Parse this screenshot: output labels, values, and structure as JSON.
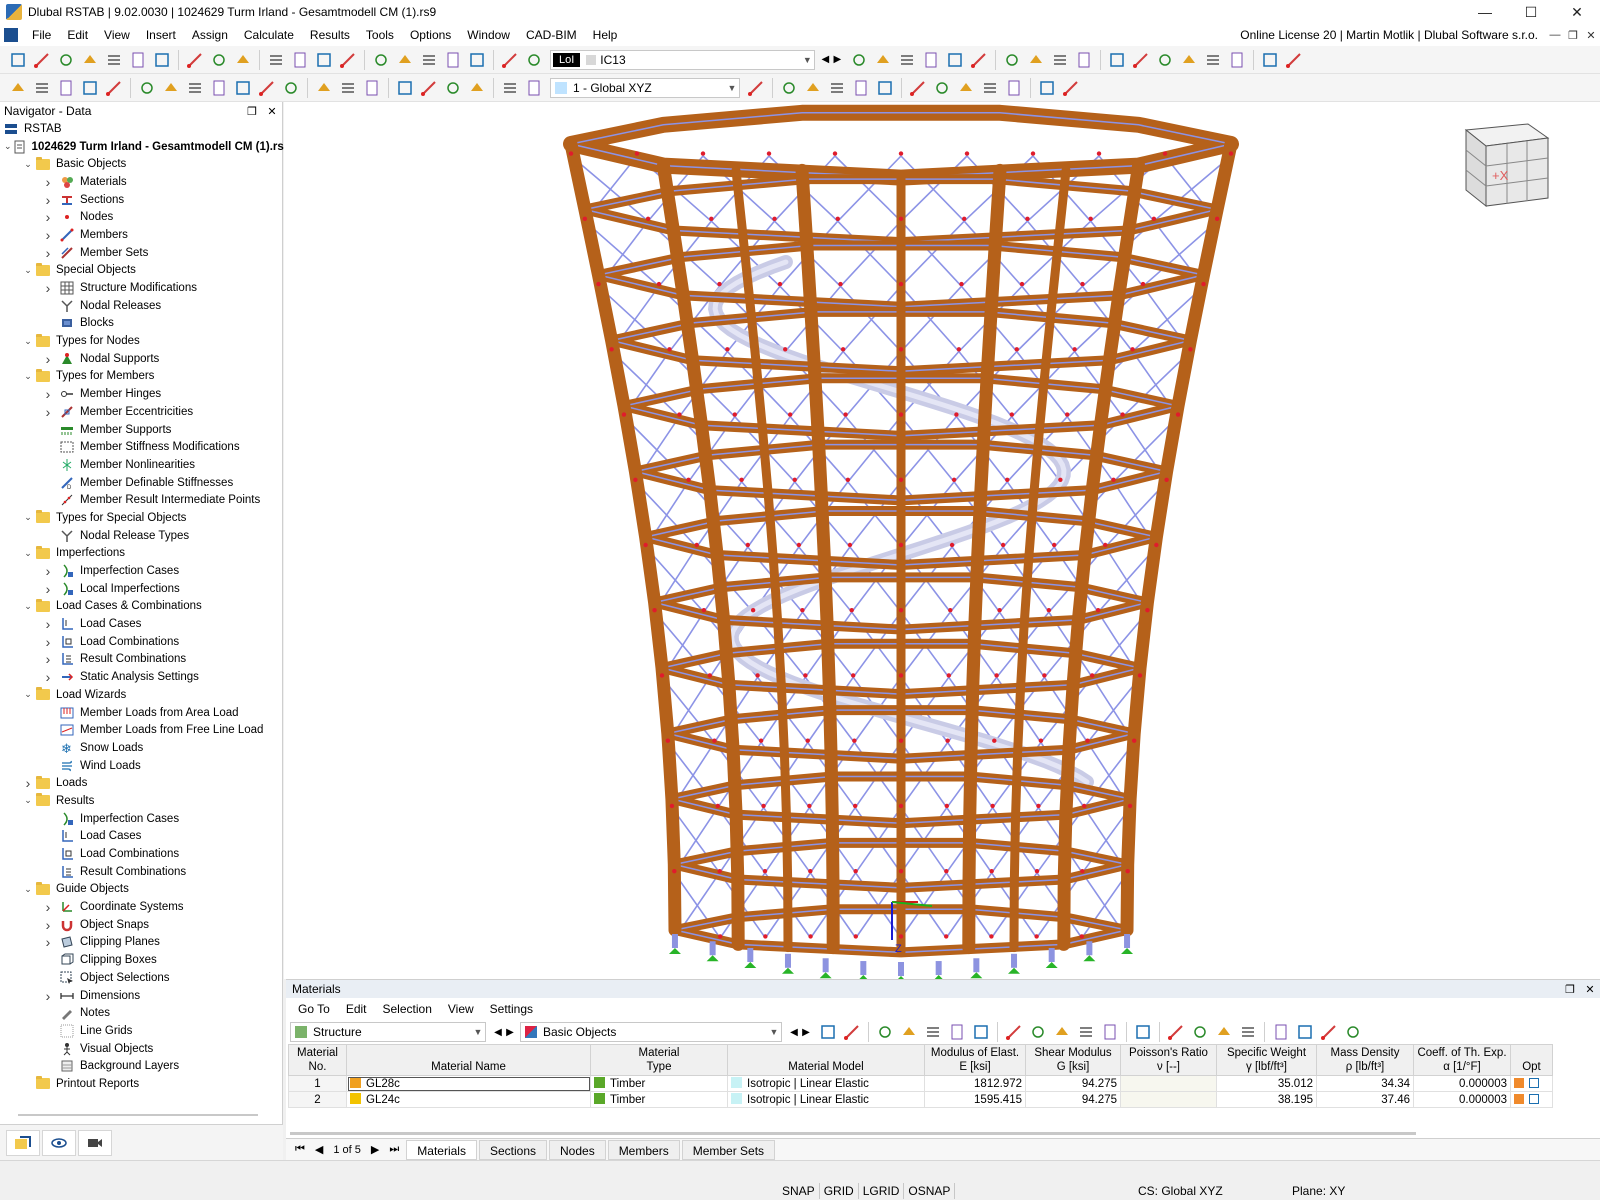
{
  "window": {
    "title": "Dlubal RSTAB | 9.02.0030 | 1024629 Turm Irland - Gesamtmodell CM (1).rs9",
    "minimize": "—",
    "maximize": "☐",
    "close": "✕"
  },
  "menu": {
    "items": [
      "File",
      "Edit",
      "View",
      "Insert",
      "Assign",
      "Calculate",
      "Results",
      "Tools",
      "Options",
      "Window",
      "CAD-BIM",
      "Help"
    ],
    "license": "Online License 20 | Martin Motlik | Dlubal Software s.r.o."
  },
  "toolbar": {
    "load_case_tag": "LoI",
    "load_case": "IC13",
    "coordinate_system": "1 - Global XYZ"
  },
  "navigator": {
    "title": "Navigator - Data",
    "root": "RSTAB",
    "model": "1024629 Turm Irland - Gesamtmodell CM (1).rs9",
    "items": [
      {
        "label": "Basic Objects",
        "level": 1,
        "kind": "folder",
        "state": "open"
      },
      {
        "label": "Materials",
        "level": 2,
        "kind": "materials-icon",
        "state": "closed"
      },
      {
        "label": "Sections",
        "level": 2,
        "kind": "sections-icon",
        "state": "closed"
      },
      {
        "label": "Nodes",
        "level": 2,
        "kind": "nodes-icon",
        "state": "closed"
      },
      {
        "label": "Members",
        "level": 2,
        "kind": "members-icon",
        "state": "closed"
      },
      {
        "label": "Member Sets",
        "level": 2,
        "kind": "member-sets-icon",
        "state": "closed"
      },
      {
        "label": "Special Objects",
        "level": 1,
        "kind": "folder",
        "state": "open"
      },
      {
        "label": "Structure Modifications",
        "level": 2,
        "kind": "grid-icon",
        "state": "closed"
      },
      {
        "label": "Nodal Releases",
        "level": 2,
        "kind": "release-icon",
        "state": "none"
      },
      {
        "label": "Blocks",
        "level": 2,
        "kind": "block-icon",
        "state": "none"
      },
      {
        "label": "Types for Nodes",
        "level": 1,
        "kind": "folder",
        "state": "open"
      },
      {
        "label": "Nodal Supports",
        "level": 2,
        "kind": "support-icon",
        "state": "closed"
      },
      {
        "label": "Types for Members",
        "level": 1,
        "kind": "folder",
        "state": "open"
      },
      {
        "label": "Member Hinges",
        "level": 2,
        "kind": "hinge-icon",
        "state": "closed"
      },
      {
        "label": "Member Eccentricities",
        "level": 2,
        "kind": "eccentricity-icon",
        "state": "closed"
      },
      {
        "label": "Member Supports",
        "level": 2,
        "kind": "member-support-icon",
        "state": "none"
      },
      {
        "label": "Member Stiffness Modifications",
        "level": 2,
        "kind": "stiffness-icon",
        "state": "none"
      },
      {
        "label": "Member Nonlinearities",
        "level": 2,
        "kind": "nonlinear-icon",
        "state": "none"
      },
      {
        "label": "Member Definable Stiffnesses",
        "level": 2,
        "kind": "definable-icon",
        "state": "none"
      },
      {
        "label": "Member Result Intermediate Points",
        "level": 2,
        "kind": "points-icon",
        "state": "none"
      },
      {
        "label": "Types for Special Objects",
        "level": 1,
        "kind": "folder",
        "state": "open"
      },
      {
        "label": "Nodal Release Types",
        "level": 2,
        "kind": "release-icon",
        "state": "none"
      },
      {
        "label": "Imperfections",
        "level": 1,
        "kind": "folder",
        "state": "open"
      },
      {
        "label": "Imperfection Cases",
        "level": 2,
        "kind": "imperfection-icon",
        "state": "closed"
      },
      {
        "label": "Local Imperfections",
        "level": 2,
        "kind": "imperfection-icon",
        "state": "closed"
      },
      {
        "label": "Load Cases & Combinations",
        "level": 1,
        "kind": "folder",
        "state": "open"
      },
      {
        "label": "Load Cases",
        "level": 2,
        "kind": "load-case-icon",
        "state": "closed"
      },
      {
        "label": "Load Combinations",
        "level": 2,
        "kind": "load-combination-icon",
        "state": "closed"
      },
      {
        "label": "Result Combinations",
        "level": 2,
        "kind": "result-combination-icon",
        "state": "closed"
      },
      {
        "label": "Static Analysis Settings",
        "level": 2,
        "kind": "analysis-icon",
        "state": "closed"
      },
      {
        "label": "Load Wizards",
        "level": 1,
        "kind": "folder",
        "state": "open"
      },
      {
        "label": "Member Loads from Area Load",
        "level": 2,
        "kind": "area-load-icon",
        "state": "none"
      },
      {
        "label": "Member Loads from Free Line Load",
        "level": 2,
        "kind": "line-load-icon",
        "state": "none"
      },
      {
        "label": "Snow Loads",
        "level": 2,
        "kind": "snow-icon",
        "state": "none"
      },
      {
        "label": "Wind Loads",
        "level": 2,
        "kind": "wind-icon",
        "state": "none"
      },
      {
        "label": "Loads",
        "level": 1,
        "kind": "folder",
        "state": "closed"
      },
      {
        "label": "Results",
        "level": 1,
        "kind": "folder",
        "state": "open"
      },
      {
        "label": "Imperfection Cases",
        "level": 2,
        "kind": "imperfection-icon",
        "state": "none"
      },
      {
        "label": "Load Cases",
        "level": 2,
        "kind": "load-case-icon",
        "state": "none"
      },
      {
        "label": "Load Combinations",
        "level": 2,
        "kind": "load-combination-icon",
        "state": "none"
      },
      {
        "label": "Result Combinations",
        "level": 2,
        "kind": "result-combination-icon",
        "state": "none"
      },
      {
        "label": "Guide Objects",
        "level": 1,
        "kind": "folder",
        "state": "open"
      },
      {
        "label": "Coordinate Systems",
        "level": 2,
        "kind": "coordinate-icon",
        "state": "closed"
      },
      {
        "label": "Object Snaps",
        "level": 2,
        "kind": "snap-icon",
        "state": "closed"
      },
      {
        "label": "Clipping Planes",
        "level": 2,
        "kind": "clipping-plane-icon",
        "state": "closed"
      },
      {
        "label": "Clipping Boxes",
        "level": 2,
        "kind": "clipping-box-icon",
        "state": "none"
      },
      {
        "label": "Object Selections",
        "level": 2,
        "kind": "selection-icon",
        "state": "none"
      },
      {
        "label": "Dimensions",
        "level": 2,
        "kind": "dimension-icon",
        "state": "closed"
      },
      {
        "label": "Notes",
        "level": 2,
        "kind": "notes-icon",
        "state": "none"
      },
      {
        "label": "Line Grids",
        "level": 2,
        "kind": "line-grid-icon",
        "state": "none"
      },
      {
        "label": "Visual Objects",
        "level": 2,
        "kind": "visual-icon",
        "state": "none"
      },
      {
        "label": "Background Layers",
        "level": 2,
        "kind": "layers-icon",
        "state": "none"
      },
      {
        "label": "Printout Reports",
        "level": 1,
        "kind": "folder",
        "state": "none"
      }
    ]
  },
  "viewport": {
    "view_cube_label": "+X",
    "axis_label": "Z"
  },
  "materials_panel": {
    "title": "Materials",
    "menu": [
      "Go To",
      "Edit",
      "Selection",
      "View",
      "Settings"
    ],
    "filter1": "Structure",
    "filter2": "Basic Objects",
    "columns": [
      {
        "line1": "Material",
        "line2": "No."
      },
      {
        "line1": "",
        "line2": "Material Name"
      },
      {
        "line1": "Material",
        "line2": "Type"
      },
      {
        "line1": "",
        "line2": "Material Model"
      },
      {
        "line1": "Modulus of Elast.",
        "line2": "E [ksi]"
      },
      {
        "line1": "Shear Modulus",
        "line2": "G [ksi]"
      },
      {
        "line1": "Poisson's Ratio",
        "line2": "ν [--]"
      },
      {
        "line1": "Specific Weight",
        "line2": "γ [lbf/ft³]"
      },
      {
        "line1": "Mass Density",
        "line2": "ρ [lb/ft³]"
      },
      {
        "line1": "Coeff. of Th. Exp.",
        "line2": "α [1/°F]"
      },
      {
        "line1": "",
        "line2": "Opt"
      }
    ],
    "rows": [
      {
        "no": "1",
        "name": "GL28c",
        "name_color": "#f0a020",
        "type": "Timber",
        "type_color": "#5aa829",
        "model": "Isotropic | Linear Elastic",
        "E": "1812.972",
        "G": "94.275",
        "nu": "",
        "gamma": "35.012",
        "rho": "34.34",
        "alpha": "0.000003"
      },
      {
        "no": "2",
        "name": "GL24c",
        "name_color": "#f2c300",
        "type": "Timber",
        "type_color": "#5aa829",
        "model": "Isotropic | Linear Elastic",
        "E": "1595.415",
        "G": "94.275",
        "nu": "",
        "gamma": "38.195",
        "rho": "37.46",
        "alpha": "0.000003"
      }
    ],
    "pager": "1 of 5",
    "tabs": [
      "Materials",
      "Sections",
      "Nodes",
      "Members",
      "Member Sets"
    ],
    "active_tab": "Materials"
  },
  "statusbar": {
    "toggles": [
      "SNAP",
      "GRID",
      "LGRID",
      "OSNAP"
    ],
    "cs": "CS: Global XYZ",
    "plane": "Plane: XY"
  },
  "colors": {
    "timber": "#b5611a",
    "bracing": "#8c93e6",
    "stair": "#c9cbe6",
    "accent": "#1b4e8f"
  }
}
